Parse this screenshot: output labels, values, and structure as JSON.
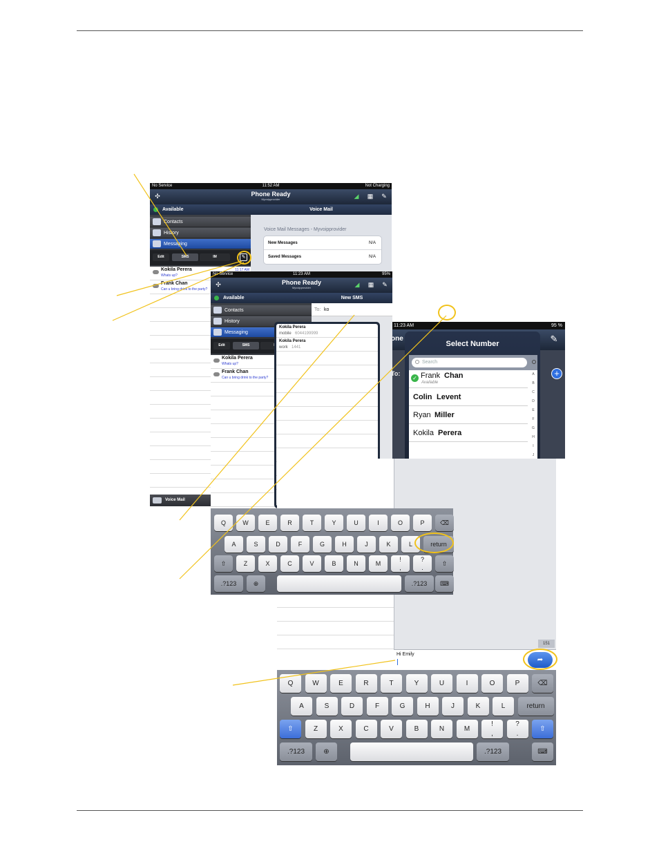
{
  "screen1": {
    "status": {
      "left": "No Service",
      "time": "11:52 AM",
      "right": "Not Charging"
    },
    "nav_title": "Phone Ready",
    "nav_subtitle": "Myvoipprovider",
    "presence": "Available",
    "detail_title": "Voice Mail",
    "sidebar": [
      "Contacts",
      "History",
      "Messaging"
    ],
    "segments": [
      "Edit",
      "SMS",
      "IM"
    ],
    "voicemail_heading": "Voice Mail Messages - Myvoipprovider",
    "voicemail_rows": [
      {
        "label": "New Messages",
        "value": "N/A"
      },
      {
        "label": "Saved Messages",
        "value": "N/A"
      }
    ],
    "messages": [
      {
        "name": "Kokila Perera",
        "text": "Whats up?",
        "time": "11:17 AM"
      },
      {
        "name": "Frank Chan",
        "text": "Can u bring drink to the party?"
      }
    ],
    "bottom_tab": "Voice Mail"
  },
  "screen2": {
    "status": {
      "left": "No Service",
      "time": "11:23 AM",
      "right": "95%"
    },
    "nav_title": "Phone Ready",
    "nav_subtitle": "Myvoipprovider",
    "presence": "Available",
    "detail_title": "New SMS",
    "sidebar": [
      "Contacts",
      "History",
      "Messaging"
    ],
    "segments": [
      "Edit",
      "SMS",
      "IM"
    ],
    "to_label": "To:",
    "to_value": "ko",
    "messages": [
      {
        "name": "Kokila Perera",
        "text": "Whats up?"
      },
      {
        "name": "Frank Chan",
        "text": "Can u bring drink to the party?"
      }
    ],
    "suggestions": [
      {
        "name": "Kokila Perera",
        "type": "mobile",
        "number": "6044199999"
      },
      {
        "name": "Kokila Perera",
        "type": "work",
        "number": "1441"
      }
    ]
  },
  "screen3": {
    "time": "11:23 AM",
    "battery": "95 %",
    "title": "Select Number",
    "search_placeholder": "Search",
    "partial_left": "one",
    "partial_to": "To:",
    "contacts": [
      {
        "first": "Frank",
        "last": "Chan",
        "status": "Available"
      },
      {
        "first": "Colin",
        "last": "Levent"
      },
      {
        "first": "Ryan",
        "last": "Miller"
      },
      {
        "first": "Kokila",
        "last": "Perera"
      }
    ],
    "index": [
      "A",
      "B",
      "C",
      "D",
      "E",
      "F",
      "G",
      "H",
      "I",
      "J"
    ]
  },
  "keyboard_small": {
    "row1": [
      "Q",
      "W",
      "E",
      "R",
      "T",
      "Y",
      "U",
      "I",
      "O",
      "P"
    ],
    "row2": [
      "A",
      "S",
      "D",
      "F",
      "G",
      "H",
      "J",
      "K",
      "L"
    ],
    "row3": [
      "Z",
      "X",
      "C",
      "V",
      "B",
      "N",
      "M"
    ],
    "return": "return",
    "num": ".?123",
    "punct1_top": "!",
    "punct1_bot": ",",
    "punct2_top": "?",
    "punct2_bot": "."
  },
  "composer": {
    "char_count": "151",
    "text": "Hi Emily"
  },
  "keyboard_large": {
    "row1": [
      "Q",
      "W",
      "E",
      "R",
      "T",
      "Y",
      "U",
      "I",
      "O",
      "P"
    ],
    "row2": [
      "A",
      "S",
      "D",
      "F",
      "G",
      "H",
      "J",
      "K",
      "L"
    ],
    "row3": [
      "Z",
      "X",
      "C",
      "V",
      "B",
      "N",
      "M"
    ],
    "return": "return",
    "num": ".?123",
    "punct1_top": "!",
    "punct1_bot": ",",
    "punct2_top": "?",
    "punct2_bot": "."
  },
  "colors": {
    "callout": "#f1c21b",
    "nav_dark": "#1d2738",
    "accent_blue": "#2f6fe0"
  }
}
